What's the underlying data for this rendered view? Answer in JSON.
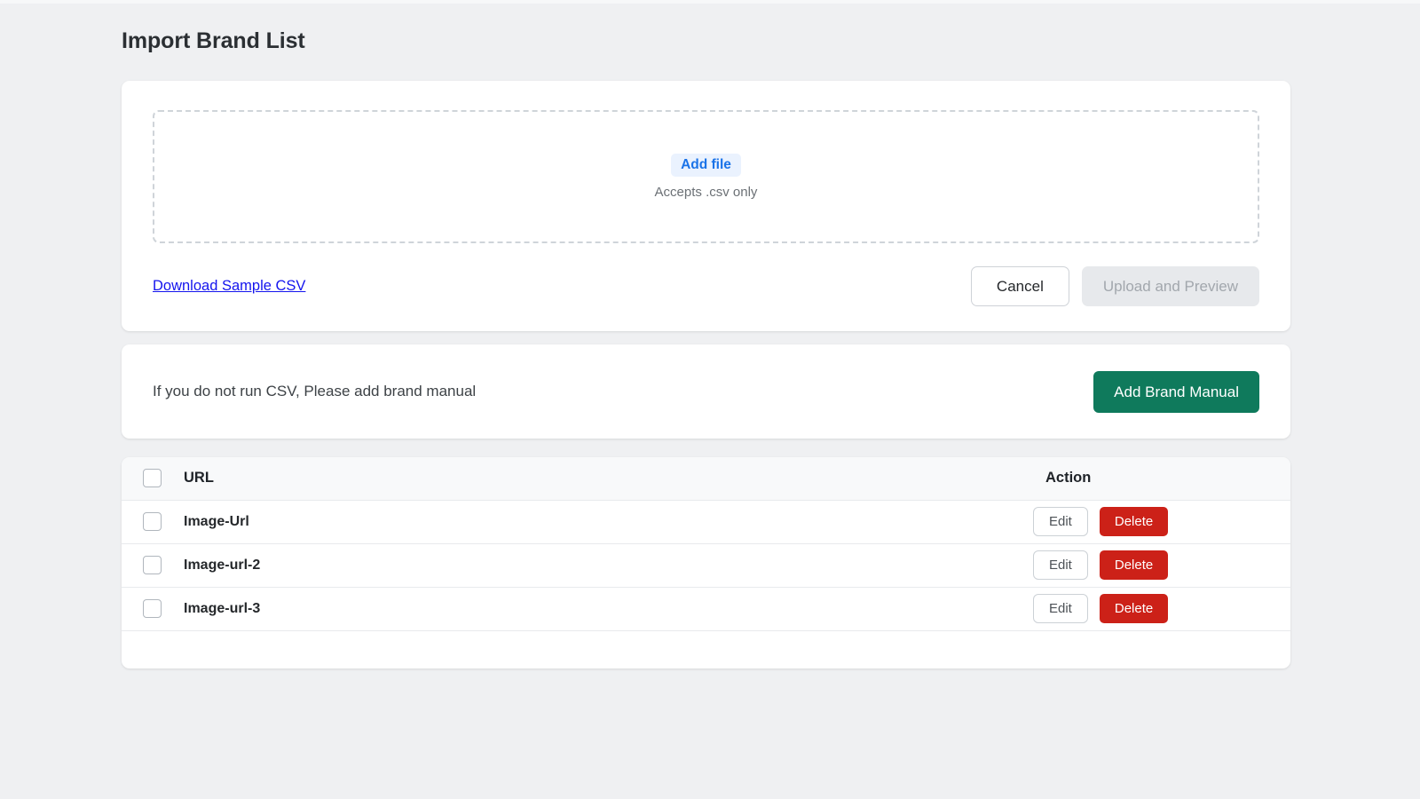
{
  "page": {
    "title": "Import Brand List",
    "background_color": "#eff0f2"
  },
  "upload_card": {
    "dropzone": {
      "add_file_label": "Add file",
      "hint": "Accepts .csv only"
    },
    "sample_link": "Download Sample CSV",
    "cancel_label": "Cancel",
    "upload_label": "Upload and Preview",
    "accent_color": "#1a73e8",
    "link_color": "#1414ee"
  },
  "manual_card": {
    "message": "If you do not run CSV, Please add brand manual",
    "button_label": "Add Brand Manual",
    "button_color": "#0f7a5c"
  },
  "table": {
    "columns": [
      "URL",
      "Action"
    ],
    "select_all_checked": false,
    "edit_label": "Edit",
    "delete_label": "Delete",
    "delete_color": "#cc2118",
    "rows": [
      {
        "url": "Image-Url",
        "checked": false
      },
      {
        "url": "Image-url-2",
        "checked": false
      },
      {
        "url": "Image-url-3",
        "checked": false
      }
    ]
  }
}
